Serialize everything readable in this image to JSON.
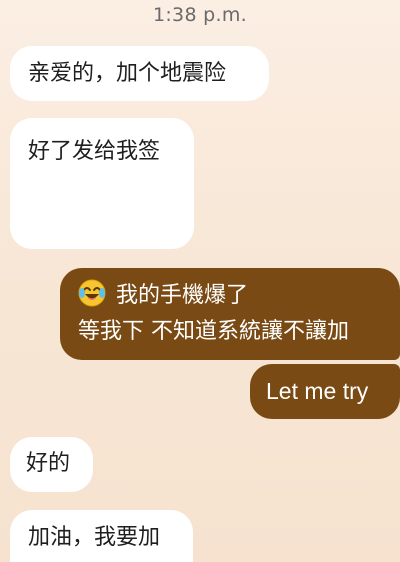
{
  "status": {
    "time": "1:38 p.m."
  },
  "messages": {
    "m1": {
      "text": "亲爱的，加个地震险"
    },
    "m2": {
      "text": "好了发给我签"
    },
    "m3": {
      "emoji": "laughing-crying-emoji",
      "line1": "我的手機爆了",
      "line2": "等我下 不知道系統讓不讓加"
    },
    "m4": {
      "text": "Let me try"
    },
    "m5": {
      "text": "好的"
    },
    "m6": {
      "text": "加油，我要加"
    }
  },
  "colors": {
    "outgoing_bubble": "#7a4a14",
    "incoming_bubble": "#ffffff",
    "background": "#f8e7d6"
  }
}
